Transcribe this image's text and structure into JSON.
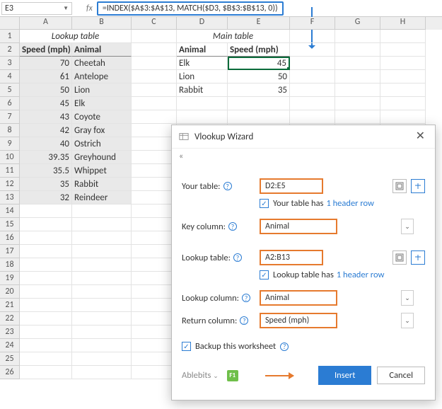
{
  "formula_bar": {
    "namebox": "E3",
    "fx": "fx",
    "formula": "=INDEX($A$3:$A$13, MATCH($D3, $B$3:$B$13, 0))"
  },
  "columns": [
    "A",
    "B",
    "C",
    "D",
    "E",
    "F",
    "G",
    "H"
  ],
  "row_labels": [
    "1",
    "2",
    "3",
    "4",
    "5",
    "6",
    "7",
    "8",
    "9",
    "10",
    "11",
    "12",
    "13",
    "14",
    "15",
    "16",
    "17",
    "18",
    "19",
    "20",
    "21",
    "22",
    "23",
    "24",
    "25",
    "26"
  ],
  "lookup_title": "Lookup table",
  "main_title": "Main table",
  "lookup_headers": {
    "speed": "Speed (mph)",
    "animal": "Animal"
  },
  "main_headers": {
    "animal": "Animal",
    "speed": "Speed (mph)"
  },
  "lookup_rows": [
    {
      "speed": "70",
      "animal": "Cheetah"
    },
    {
      "speed": "61",
      "animal": "Antelope"
    },
    {
      "speed": "50",
      "animal": "Lion"
    },
    {
      "speed": "45",
      "animal": "Elk"
    },
    {
      "speed": "43",
      "animal": "Coyote"
    },
    {
      "speed": "42",
      "animal": "Gray fox"
    },
    {
      "speed": "40",
      "animal": "Ostrich"
    },
    {
      "speed": "39.35",
      "animal": "Greyhound"
    },
    {
      "speed": "35.5",
      "animal": "Whippet"
    },
    {
      "speed": "35",
      "animal": "Rabbit"
    },
    {
      "speed": "32",
      "animal": "Reindeer"
    }
  ],
  "main_rows": [
    {
      "animal": "Elk",
      "speed": "45"
    },
    {
      "animal": "Lion",
      "speed": "50"
    },
    {
      "animal": "Rabbit",
      "speed": "35"
    }
  ],
  "dialog": {
    "title": "Vlookup Wizard",
    "back": "«",
    "your_table_label": "Your table:",
    "your_table": "D2:E5",
    "your_table_has": "Your table has",
    "one_header": "1 header row",
    "key_col_label": "Key column:",
    "key_col": "Animal",
    "lookup_table_label": "Lookup table:",
    "lookup_table": "A2:B13",
    "lookup_has": "Lookup table has",
    "lookup_col_label": "Lookup column:",
    "lookup_col": "Animal",
    "return_col_label": "Return column:",
    "return_col": "Speed (mph)",
    "backup": "Backup this worksheet",
    "brand": "Ablebits",
    "f1": "F1",
    "insert": "Insert",
    "cancel": "Cancel"
  }
}
